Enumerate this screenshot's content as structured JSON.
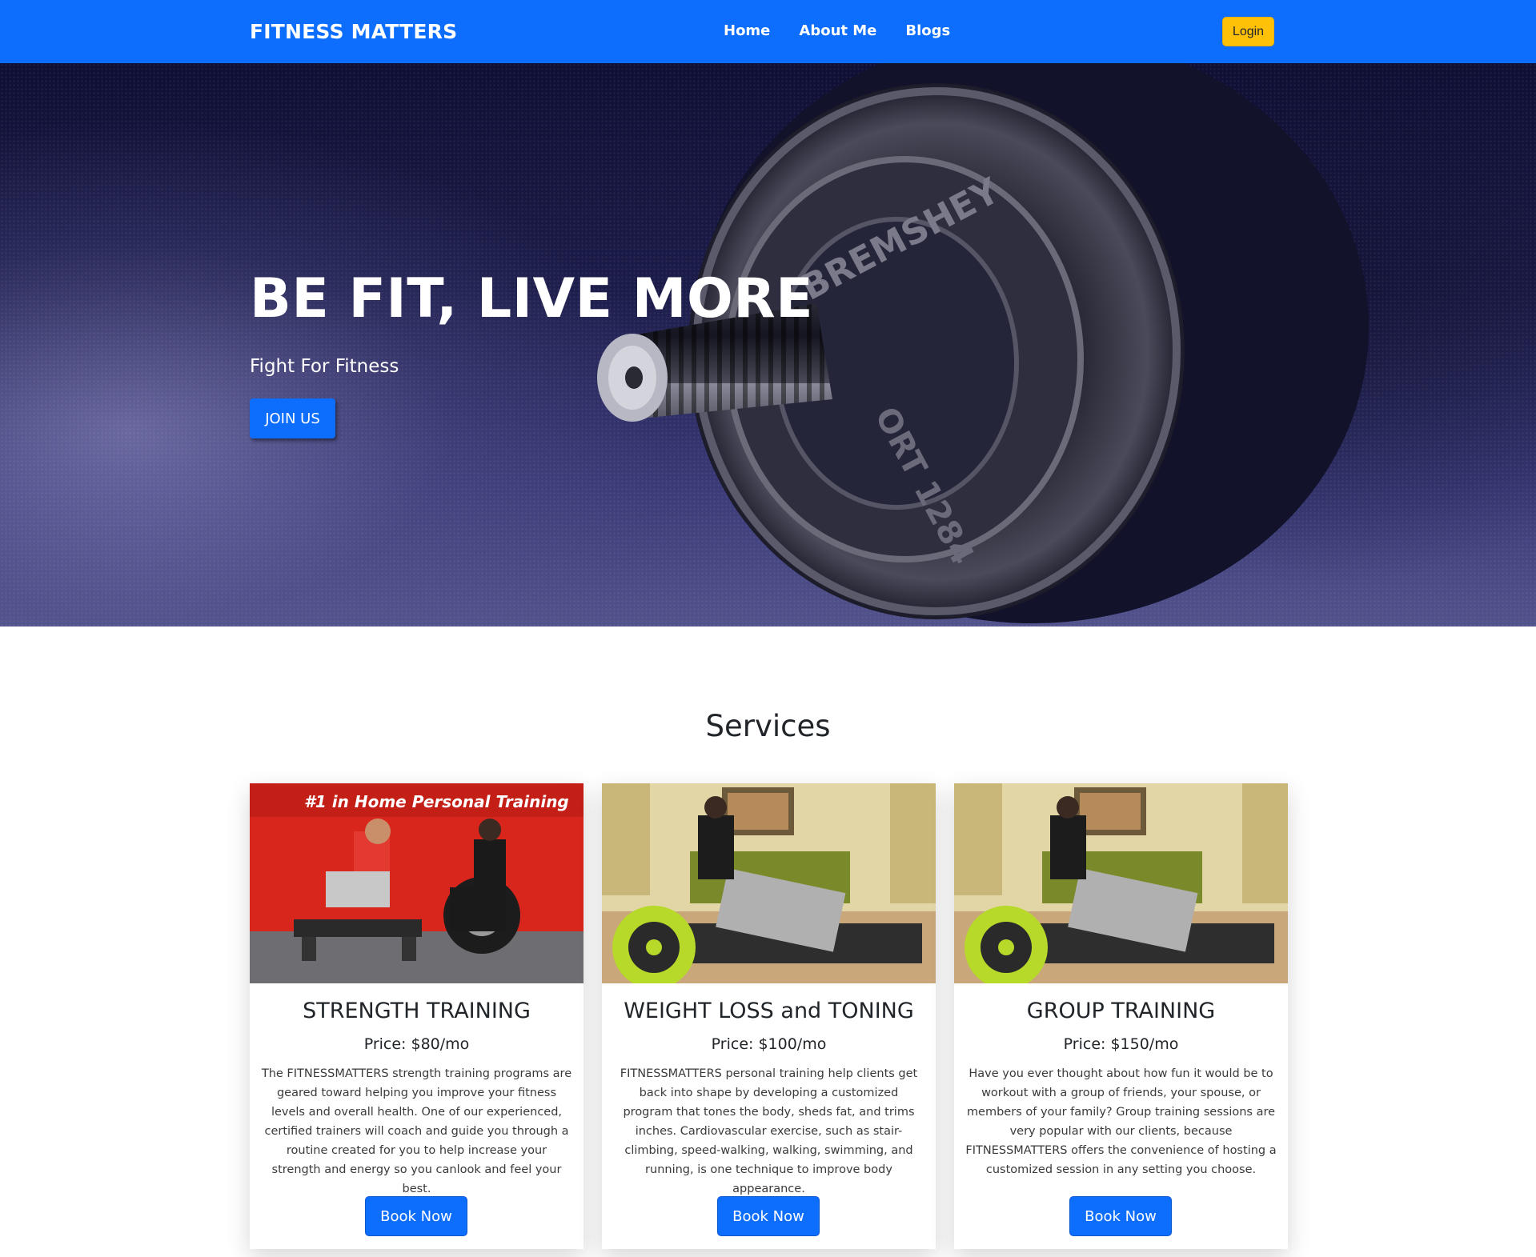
{
  "navbar": {
    "brand": "FITNESS MATTERS",
    "links": [
      {
        "label": "Home"
      },
      {
        "label": "About Me"
      },
      {
        "label": "Blogs"
      }
    ],
    "login_label": "Login"
  },
  "hero": {
    "title": "BE FIT, LIVE MORE",
    "subtitle": "Fight For Fitness",
    "cta_label": "JOIN US",
    "plate_text_top": "BREMSHEY",
    "plate_text_bottom": "ORT 1284"
  },
  "services": {
    "heading": "Services",
    "cards": [
      {
        "title": "STRENGTH TRAINING",
        "price": "Price: $80/mo",
        "description": "The FITNESSMATTERS strength training programs are geared toward helping you improve your fitness levels and overall health. One of our experienced, certified trainers will coach and guide you through a routine created for you to help increase your strength and energy so you canlook and feel your best.",
        "button_label": "Book Now",
        "image_banner": "#1 in Home Personal Training"
      },
      {
        "title": "WEIGHT LOSS and TONING",
        "price": "Price: $100/mo",
        "description": "FITNESSMATTERS personal training help clients get back into shape by developing a customized program that tones the body, sheds fat, and trims inches. Cardiovascular exercise, such as stair-climbing, speed-walking, walking, swimming, and running, is one technique to improve body appearance.",
        "button_label": "Book Now"
      },
      {
        "title": "GROUP TRAINING",
        "price": "Price: $150/mo",
        "description": "Have you ever thought about how fun it would be to workout with a group of friends, your spouse, or members of your family? Group training sessions are very popular with our clients, because FITNESSMATTERS offers the convenience of hosting a customized session in any setting you choose.",
        "button_label": "Book Now"
      }
    ]
  },
  "colors": {
    "primary": "#0d6efd",
    "login": "#ffc107",
    "text": "#212529"
  }
}
